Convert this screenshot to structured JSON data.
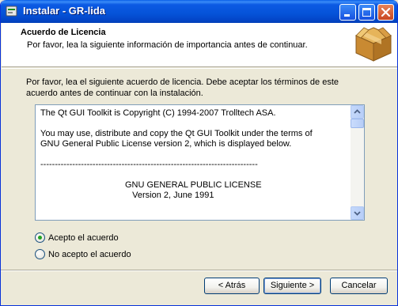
{
  "window": {
    "title": "Instalar - GR-lida",
    "icon": "installer-icon",
    "controls": [
      "minimize-icon",
      "maximize-icon",
      "close-icon"
    ]
  },
  "header": {
    "title": "Acuerdo de Licencia",
    "subtitle": "Por favor, lea la siguiente información de importancia antes de continuar.",
    "icon": "box-icon"
  },
  "intro": "Por favor, lea el siguiente acuerdo de licencia. Debe aceptar los términos de este acuerdo antes de continuar con la instalación.",
  "license": {
    "text": "The Qt GUI Toolkit is Copyright (C) 1994-2007 Trolltech ASA.\n\nYou may use, distribute and copy the Qt GUI Toolkit under the terms of\nGNU General Public License version 2, which is displayed below.\n\n---------------------------------------------------------------------------\n\n                                   GNU GENERAL PUBLIC LICENSE\n                                      Version 2, June 1991"
  },
  "options": [
    {
      "label": "Acepto el acuerdo",
      "checked": true
    },
    {
      "label": "No acepto el acuerdo",
      "checked": false
    }
  ],
  "buttons": {
    "back": "< Atrás",
    "next": "Siguiente >",
    "cancel": "Cancelar"
  },
  "colors": {
    "titlebar": "#0553d8",
    "dialog_bg": "#ece9d8",
    "radio_checked": "#21a121"
  }
}
